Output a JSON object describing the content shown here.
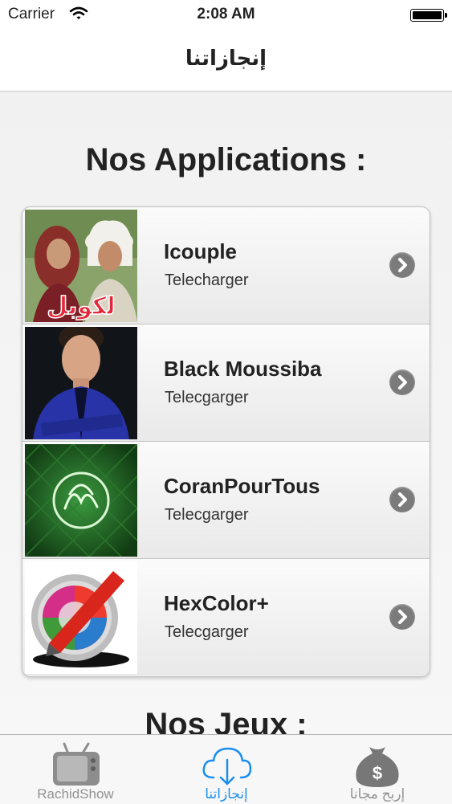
{
  "status": {
    "carrier": "Carrier",
    "time": "2:08 AM"
  },
  "nav": {
    "title": "إنجازاتنا"
  },
  "sections": {
    "apps_title": "Nos Applications :",
    "games_title": "Nos Jeux :"
  },
  "apps": [
    {
      "title": "Icouple",
      "subtitle": "Telecharger",
      "thumb_icon": "couple-poster-icon"
    },
    {
      "title": "Black Moussiba",
      "subtitle": "Telecgarger",
      "thumb_icon": "man-portrait-icon"
    },
    {
      "title": "CoranPourTous",
      "subtitle": "Telecgarger",
      "thumb_icon": "quran-calligraphy-icon"
    },
    {
      "title": "HexColor+",
      "subtitle": "Telecgarger",
      "thumb_icon": "color-picker-icon"
    }
  ],
  "thumb_text": {
    "icouple_logo": "لكوبل"
  },
  "tabs": [
    {
      "label": "RachidShow",
      "icon": "tv-icon"
    },
    {
      "label": "إنجازاتنا",
      "icon": "cloud-download-icon",
      "active": true
    },
    {
      "label": "إربح مجانا",
      "icon": "money-bag-icon"
    }
  ],
  "colors": {
    "accent": "#1a8ff0",
    "tab_inactive": "#929292",
    "chevron": "#7b7b7b"
  }
}
